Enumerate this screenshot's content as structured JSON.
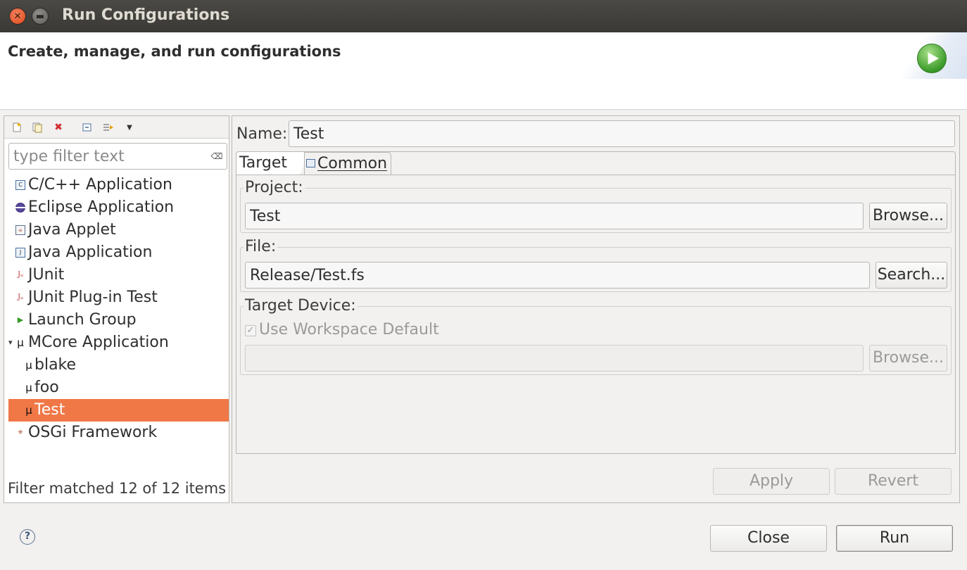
{
  "window": {
    "title": "Run Configurations"
  },
  "banner": {
    "title": "Create, manage, and run configurations"
  },
  "left": {
    "toolbar": [
      "new-configuration-icon",
      "duplicate-icon",
      "delete-icon",
      "collapse-all-icon",
      "filter-icon",
      "view-menu-icon"
    ],
    "filter_placeholder": "type filter text",
    "items": [
      {
        "label": "C/C++ Application",
        "icon": "cpp-app-icon"
      },
      {
        "label": "Eclipse Application",
        "icon": "eclipse-icon"
      },
      {
        "label": "Java Applet",
        "icon": "applet-icon"
      },
      {
        "label": "Java Application",
        "icon": "java-app-icon"
      },
      {
        "label": "JUnit",
        "icon": "junit-icon"
      },
      {
        "label": "JUnit Plug-in Test",
        "icon": "junit-plugin-icon"
      },
      {
        "label": "Launch Group",
        "icon": "launch-group-icon"
      },
      {
        "label": "MCore Application",
        "icon": "mcore-icon"
      },
      {
        "label": "blake",
        "icon": "mcore-icon"
      },
      {
        "label": "foo",
        "icon": "mcore-icon"
      },
      {
        "label": "Test",
        "icon": "mcore-icon"
      },
      {
        "label": "OSGi Framework",
        "icon": "osgi-icon"
      }
    ],
    "status": "Filter matched 12 of 12 items"
  },
  "right": {
    "name_label": "Name:",
    "name_value": "Test",
    "tabs": [
      {
        "label": "Target"
      },
      {
        "label": "Common"
      }
    ],
    "project": {
      "label": "Project:",
      "value": "Test",
      "button": "Browse..."
    },
    "file": {
      "label": "File:",
      "value": "Release/Test.fs",
      "button": "Search..."
    },
    "device": {
      "label": "Target Device:",
      "checkbox": "Use Workspace Default",
      "checked": true,
      "value": "",
      "button": "Browse..."
    },
    "apply": "Apply",
    "revert": "Revert"
  },
  "footer": {
    "close": "Close",
    "run": "Run"
  },
  "colors": {
    "selection": "#f07746",
    "titlebar": "#3c3b37",
    "close_button": "#dd4814"
  }
}
